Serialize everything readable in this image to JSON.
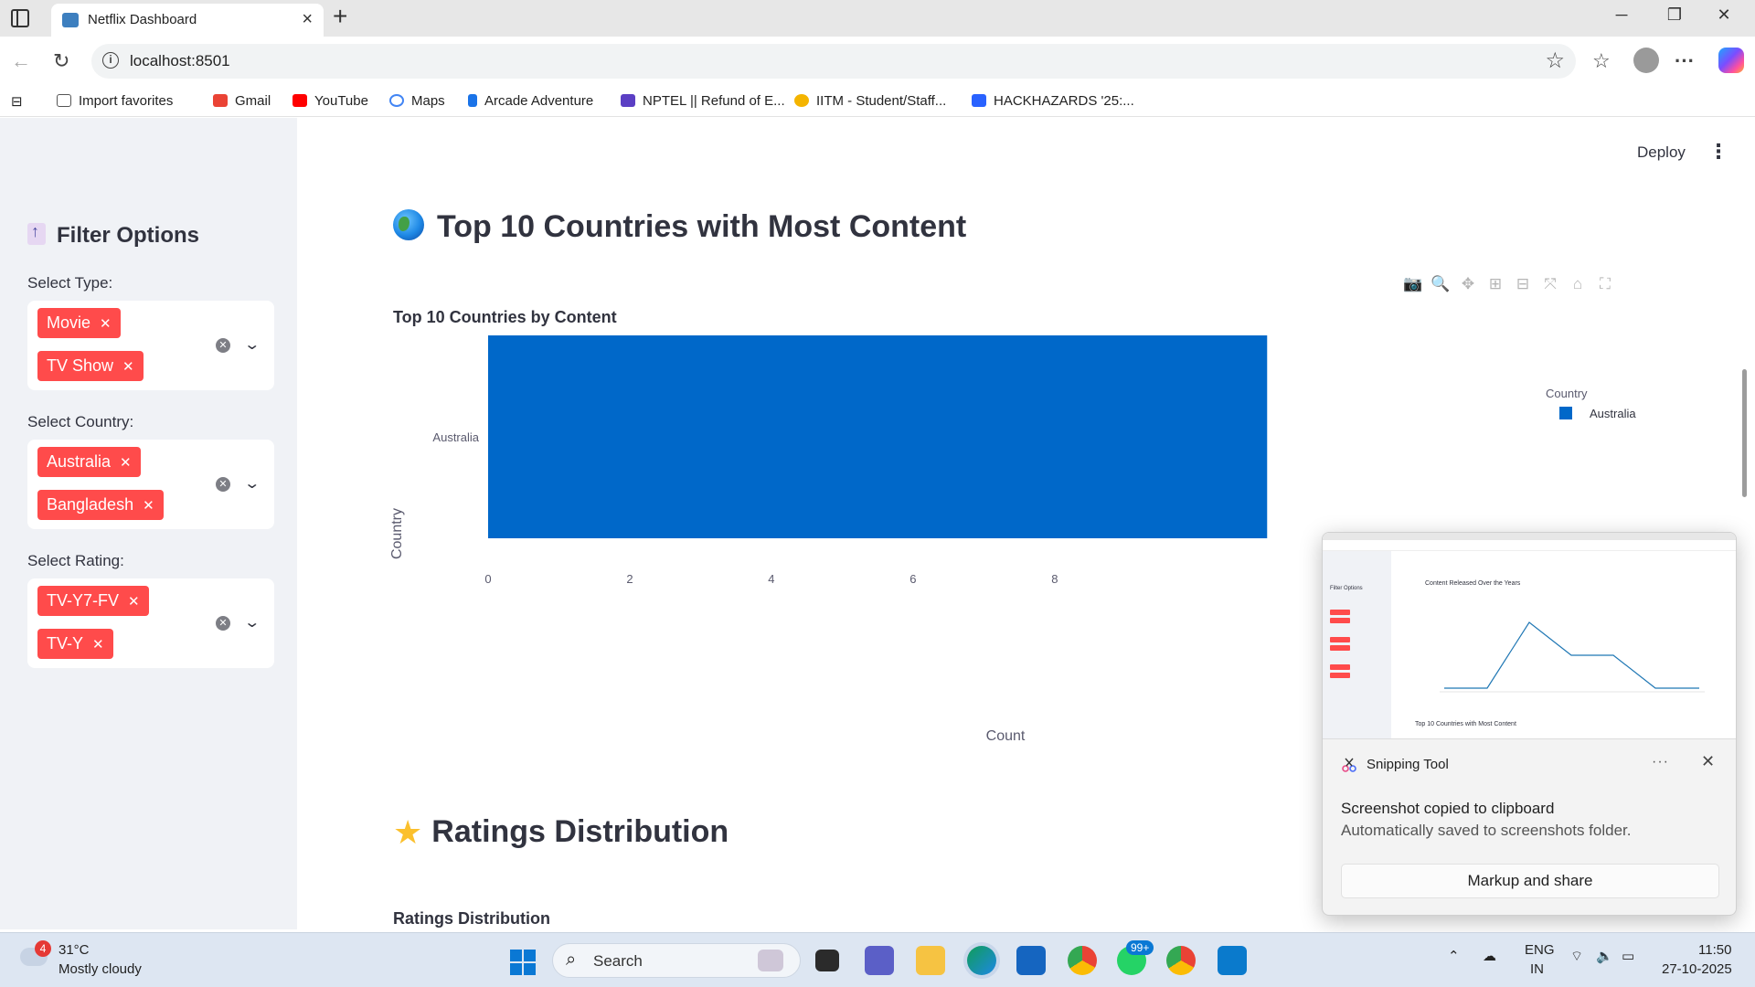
{
  "browser": {
    "tab_title": "Netflix Dashboard",
    "url": "localhost:8501",
    "bookmarks": [
      "Import favorites",
      "Gmail",
      "YouTube",
      "Maps",
      "Arcade Adventure",
      "NPTEL || Refund of E...",
      "IITM - Student/Staff...",
      "HACKHAZARDS '25:..."
    ]
  },
  "sidebar": {
    "title": "Filter Options",
    "filters": [
      {
        "label": "Select Type:",
        "chips": [
          "Movie",
          "TV Show"
        ]
      },
      {
        "label": "Select Country:",
        "chips": [
          "Australia",
          "Bangladesh"
        ]
      },
      {
        "label": "Select Rating:",
        "chips": [
          "TV-Y7-FV",
          "TV-Y"
        ]
      }
    ],
    "chip_color": "#ff4b4b"
  },
  "header": {
    "deploy_label": "Deploy"
  },
  "sections": {
    "countries_heading": "Top 10 Countries with Most Content",
    "ratings_heading": "Ratings Distribution",
    "ratings_subtitle": "Ratings Distribution"
  },
  "chart_data": {
    "type": "bar",
    "orientation": "horizontal",
    "title": "Top 10 Countries by Content",
    "xlabel": "Count",
    "ylabel": "Country",
    "categories": [
      "Australia"
    ],
    "values": [
      11
    ],
    "xlim": [
      0,
      11.5
    ],
    "x_ticks": [
      0,
      2,
      4,
      6,
      8
    ],
    "legend_title": "Country",
    "series": [
      {
        "name": "Australia",
        "values": [
          11
        ]
      }
    ],
    "legend_placement": "top-right",
    "bar_color": "#0068c9"
  },
  "toast": {
    "app": "Snipping Tool",
    "message": "Screenshot copied to clipboard",
    "sub": "Automatically saved to screenshots folder.",
    "button": "Markup and share",
    "thumb_title": "Content Released Over the Years",
    "thumb_footer": "Top 10 Countries with Most Content",
    "thumb_filter_title": "Filter Options"
  },
  "taskbar": {
    "weather_badge": "4",
    "temp": "31°C",
    "condition": "Mostly cloudy",
    "search_placeholder": "Search",
    "whatsapp_badge": "99+",
    "lang": "ENG",
    "region": "IN",
    "time": "11:50",
    "date": "27-10-2025"
  }
}
